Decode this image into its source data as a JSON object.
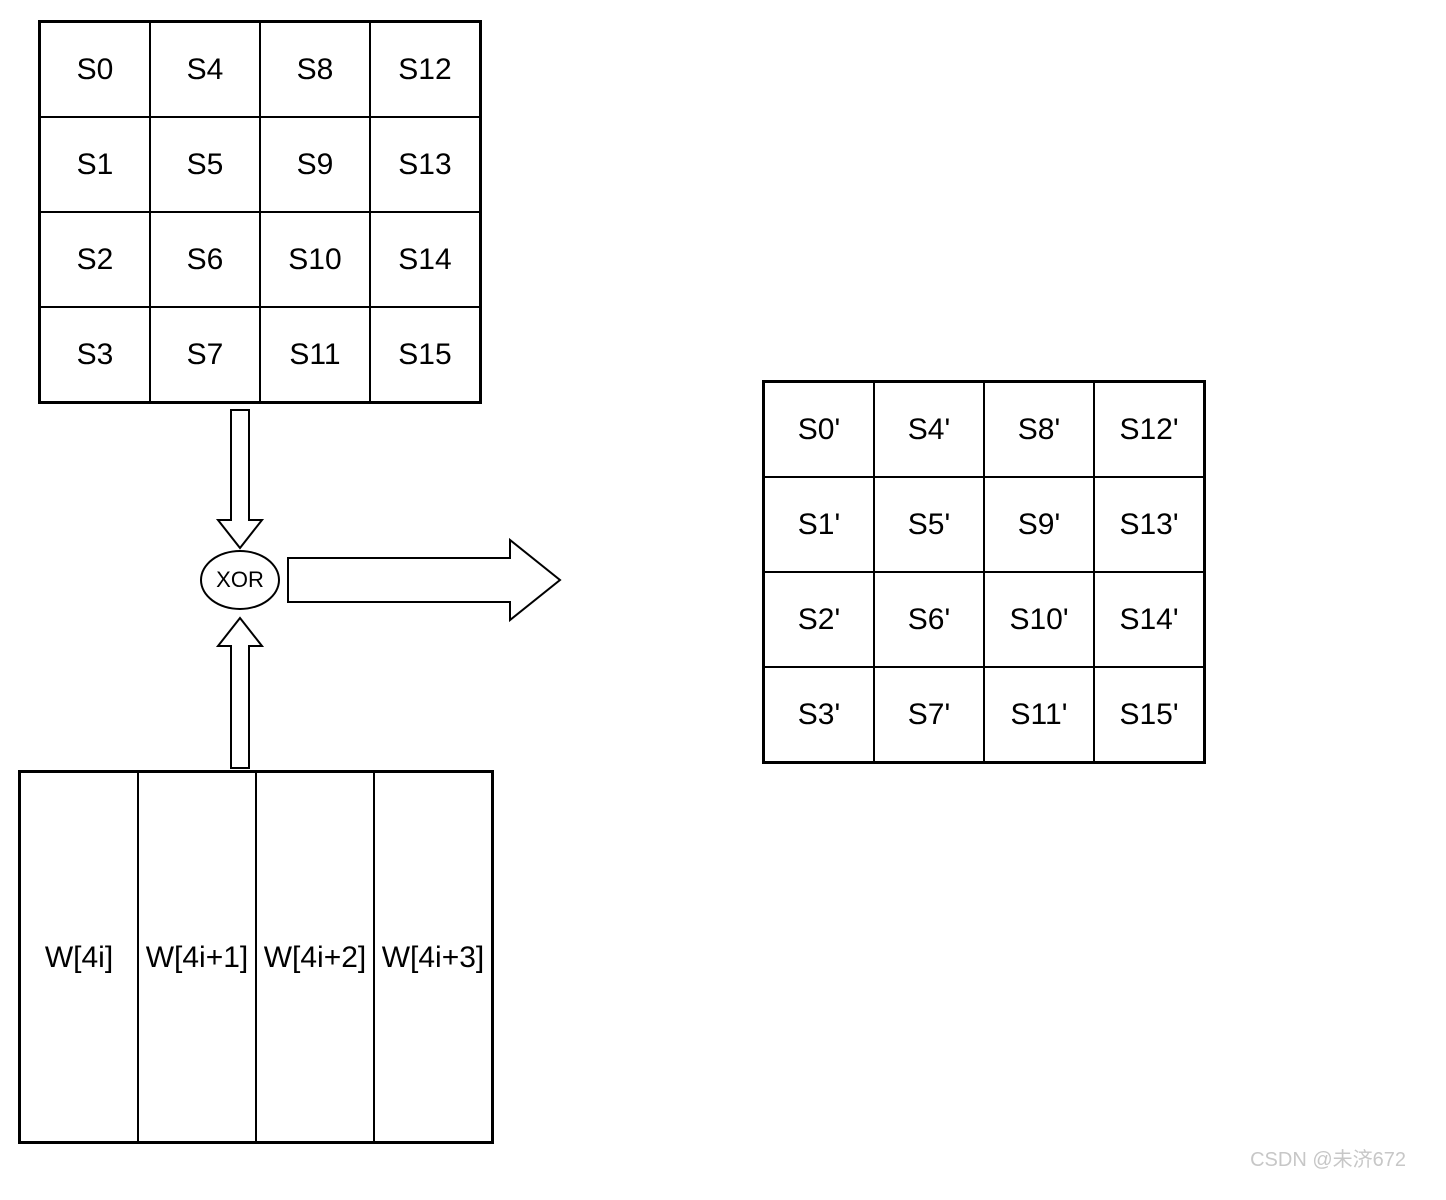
{
  "state_matrix": {
    "rows": [
      [
        "S0",
        "S4",
        "S8",
        "S12"
      ],
      [
        "S1",
        "S5",
        "S9",
        "S13"
      ],
      [
        "S2",
        "S6",
        "S10",
        "S14"
      ],
      [
        "S3",
        "S7",
        "S11",
        "S15"
      ]
    ]
  },
  "key_matrix": {
    "cells": [
      "W[4i]",
      "W[4i+1]",
      "W[4i+2]",
      "W[4i+3]"
    ]
  },
  "op": {
    "label": "XOR"
  },
  "result_matrix": {
    "rows": [
      [
        "S0'",
        "S4'",
        "S8'",
        "S12'"
      ],
      [
        "S1'",
        "S5'",
        "S9'",
        "S13'"
      ],
      [
        "S2'",
        "S6'",
        "S10'",
        "S14'"
      ],
      [
        "S3'",
        "S7'",
        "S11'",
        "S15'"
      ]
    ]
  },
  "watermark": "CSDN @未济672"
}
